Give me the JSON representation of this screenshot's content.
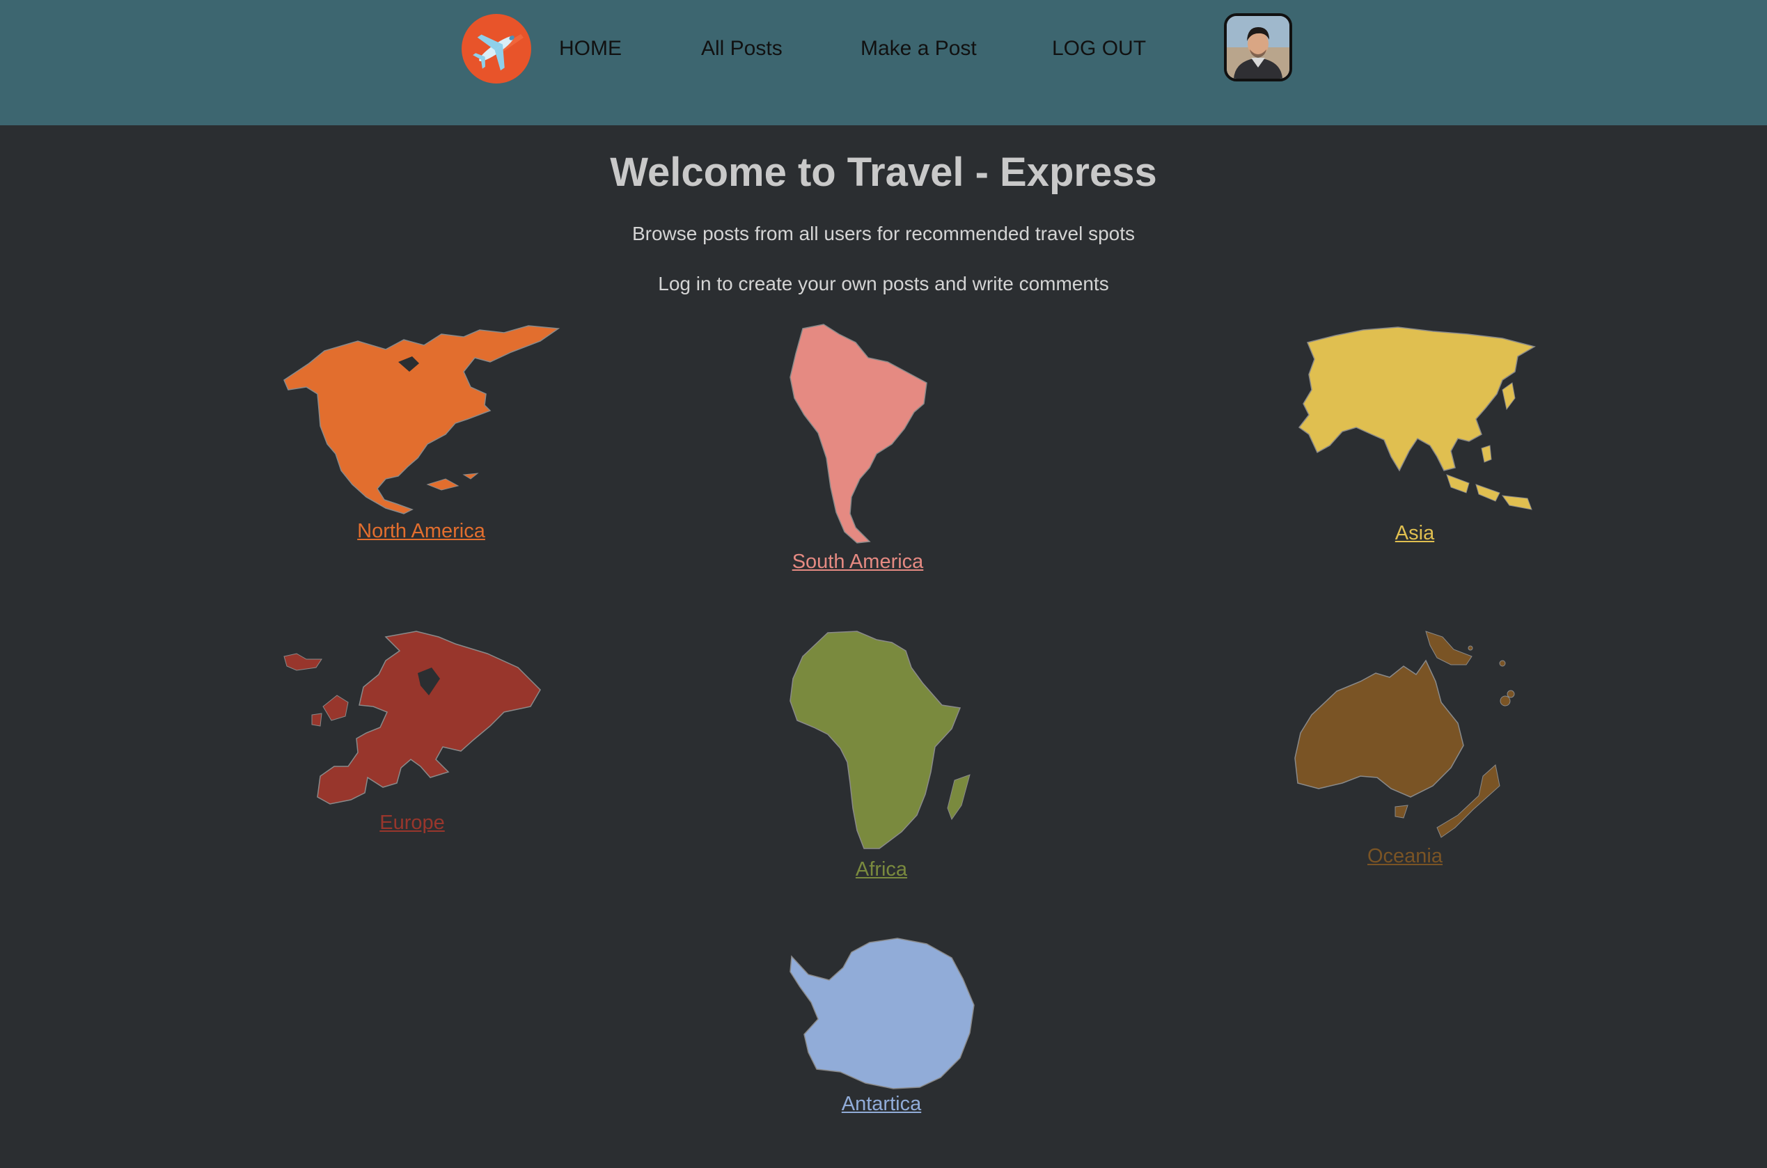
{
  "header": {
    "logo_icon": "airplane-logo-icon",
    "nav": {
      "home": "HOME",
      "all_posts": "All Posts",
      "make_post": "Make a Post",
      "logout": "LOG OUT"
    },
    "avatar_icon": "user-avatar",
    "bg_color": "#3d6670"
  },
  "hero": {
    "title": "Welcome to Travel - Express",
    "line1": "Browse posts from all users for recommended travel spots",
    "line2": "Log in to create your own posts and write comments"
  },
  "continents": {
    "north_america": {
      "label": "North America",
      "color": "#e26e2e",
      "icon": "north-america-map-icon"
    },
    "south_america": {
      "label": "South America",
      "color": "#e58a82",
      "icon": "south-america-map-icon"
    },
    "asia": {
      "label": "Asia",
      "color": "#e0bf50",
      "icon": "asia-map-icon"
    },
    "europe": {
      "label": "Europe",
      "color": "#98362c",
      "icon": "europe-map-icon"
    },
    "africa": {
      "label": "Africa",
      "color": "#7a8a3e",
      "icon": "africa-map-icon"
    },
    "oceania": {
      "label": "Oceania",
      "color": "#7a5425",
      "icon": "oceania-map-icon"
    },
    "antarctica": {
      "label": "Antartica",
      "color": "#91acd8",
      "icon": "antarctica-map-icon"
    }
  }
}
